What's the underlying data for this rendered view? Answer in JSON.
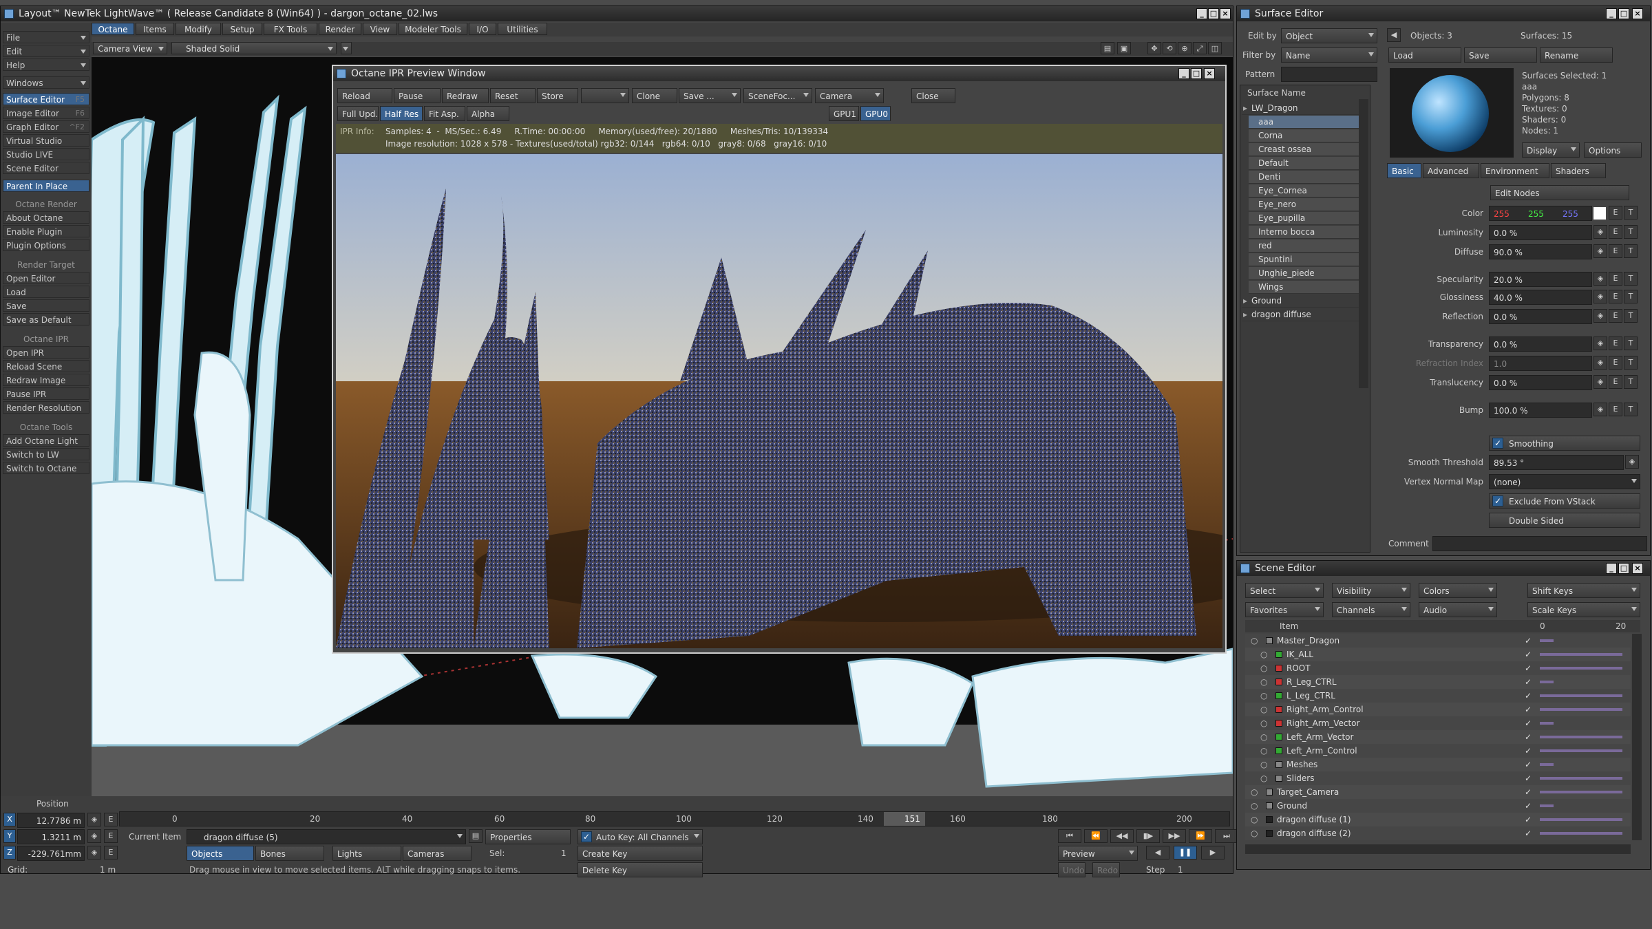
{
  "main_window": {
    "title": "Layout™ NewTek LightWave™ ( Release Candidate 8 (Win64) ) - dargon_octane_02.lws",
    "tabs": [
      "Octane",
      "Items",
      "Modify",
      "Setup",
      "FX Tools",
      "Render",
      "View",
      "Modeler Tools",
      "I/O",
      "Utilities"
    ]
  },
  "viewport_bar": {
    "camera": "Camera View",
    "shading": "Shaded Solid"
  },
  "left_menu": {
    "top": [
      {
        "label": "File"
      },
      {
        "label": "Edit"
      },
      {
        "label": "Help"
      },
      {
        "label": "Windows"
      }
    ],
    "editors": [
      {
        "label": "Surface Editor",
        "shortcut": "F5"
      },
      {
        "label": "Image Editor",
        "shortcut": "F6"
      },
      {
        "label": "Graph Editor",
        "shortcut": "^F2"
      },
      {
        "label": "Virtual Studio",
        "shortcut": ""
      },
      {
        "label": "Studio LIVE",
        "shortcut": ""
      },
      {
        "label": "Scene Editor",
        "shortcut": ""
      }
    ],
    "parent_in_place": "Parent In Place",
    "sections": [
      {
        "head": "Octane Render",
        "items": [
          "About Octane",
          "Enable Plugin",
          "Plugin Options"
        ]
      },
      {
        "head": "Render Target",
        "items": [
          "Open Editor",
          "Load",
          "Save",
          "Save as Default"
        ]
      },
      {
        "head": "Octane IPR",
        "items": [
          "Open IPR",
          "Reload Scene",
          "Redraw Image",
          "Pause IPR",
          "Render Resolution"
        ]
      },
      {
        "head": "Octane Tools",
        "items": [
          "Add Octane Light",
          "Switch to LW",
          "Switch to Octane"
        ]
      }
    ]
  },
  "ipr": {
    "title": "Octane IPR Preview Window",
    "row1": [
      "Reload",
      "Pause",
      "Redraw",
      "Reset",
      "Store",
      "",
      "Clone",
      "Save ...",
      "SceneFoc...",
      "Camera",
      "Close"
    ],
    "row2": [
      "Full Upd.",
      "Half Res",
      "Fit Asp.",
      "Alpha"
    ],
    "gpus": [
      "GPU1",
      "GPU0"
    ],
    "info_label": "IPR Info:",
    "info_line1": "Samples: 4  -  MS/Sec.: 6.49     R.Time: 00:00:00     Memory(used/free): 20/1880     Meshes/Tris: 10/139334",
    "info_line2": "Image resolution: 1028 x 578 - Textures(used/total) rgb32: 0/144   rgb64: 0/10   gray8: 0/68   gray16: 0/10"
  },
  "bottom": {
    "position_label": "Position",
    "x": "12.7786 m",
    "y": "1.3211 m",
    "z": "-229.761mm",
    "grid_label": "Grid:",
    "grid": "1 m",
    "axes": [
      "X",
      "Y",
      "Z"
    ],
    "ticks": [
      "0",
      "20",
      "40",
      "60",
      "80",
      "100",
      "120",
      "140",
      "160",
      "180",
      "200"
    ],
    "frame_start": "0",
    "frame_end": "200",
    "current_frame": "151",
    "current_item_label": "Current Item",
    "current_item": "dragon diffuse (5)",
    "properties": "Properties",
    "auto_key": "Auto Key: All Channels",
    "create_key": "Create Key",
    "delete_key": "Delete Key",
    "filters": [
      "Objects",
      "Bones",
      "Lights",
      "Cameras"
    ],
    "sel_label": "Sel:",
    "sel_value": "1",
    "status": "Drag mouse in view to move selected items. ALT while dragging snaps to items.",
    "preview": "Preview",
    "undo": "Undo",
    "redo": "Redo",
    "step_label": "Step",
    "step_value": "1"
  },
  "surface_editor": {
    "title": "Surface Editor",
    "edit_by_label": "Edit by",
    "edit_by": "Object",
    "filter_by_label": "Filter by",
    "filter_by": "Name",
    "pattern_label": "Pattern",
    "objects": "Objects: 3",
    "surfaces": "Surfaces: 15",
    "load": "Load",
    "save": "Save",
    "rename": "Rename",
    "tree_header": "Surface Name",
    "tree": [
      {
        "label": "LW_Dragon",
        "type": "group"
      },
      {
        "label": "aaa",
        "sel": true
      },
      {
        "label": "Corna"
      },
      {
        "label": "Creast ossea"
      },
      {
        "label": "Default"
      },
      {
        "label": "Denti"
      },
      {
        "label": "Eye_Cornea"
      },
      {
        "label": "Eye_nero"
      },
      {
        "label": "Eye_pupilla"
      },
      {
        "label": "Interno bocca"
      },
      {
        "label": "red"
      },
      {
        "label": "Spuntini"
      },
      {
        "label": "Unghie_piede"
      },
      {
        "label": "Wings"
      },
      {
        "label": "Ground",
        "type": "group"
      },
      {
        "label": "dragon diffuse",
        "type": "group"
      }
    ],
    "info": [
      "Surfaces Selected: 1",
      "aaa",
      "Polygons: 8",
      "Textures: 0",
      "Shaders: 0",
      "Nodes: 1"
    ],
    "display": "Display",
    "options": "Options",
    "tabs": [
      "Basic",
      "Advanced",
      "Environment",
      "Shaders"
    ],
    "edit_nodes": "Edit Nodes",
    "color_label": "Color",
    "color_r": "255",
    "color_g": "255",
    "color_b": "255",
    "props": [
      {
        "label": "Luminosity",
        "value": "0.0 %"
      },
      {
        "label": "Diffuse",
        "value": "90.0 %"
      },
      {
        "label": "Specularity",
        "value": "20.0 %"
      },
      {
        "label": "Glossiness",
        "value": "40.0 %"
      },
      {
        "label": "Reflection",
        "value": "0.0 %"
      },
      {
        "label": "Transparency",
        "value": "0.0 %"
      },
      {
        "label": "Refraction Index",
        "value": "1.0"
      },
      {
        "label": "Translucency",
        "value": "0.0 %"
      },
      {
        "label": "Bump",
        "value": "100.0 %"
      }
    ],
    "smoothing": "Smoothing",
    "smooth_threshold_label": "Smooth Threshold",
    "smooth_threshold": "89.53 °",
    "vertex_normal_label": "Vertex Normal Map",
    "vertex_normal": "(none)",
    "exclude_vstack": "Exclude From VStack",
    "double_sided": "Double Sided",
    "comment_label": "Comment",
    "e": "E",
    "t": "T"
  },
  "scene_editor": {
    "title": "Scene Editor",
    "dropdowns": [
      "Select",
      "Visibility",
      "Colors",
      "Favorites",
      "Channels",
      "Audio"
    ],
    "shift_keys": "Shift Keys",
    "scale_keys": "Scale Keys",
    "item_header": "Item",
    "tl_start": "0",
    "tl_end": "20",
    "items": [
      {
        "label": "Master_Dragon",
        "indent": 0,
        "color": "#888"
      },
      {
        "label": "IK_ALL",
        "indent": 1,
        "color": "#3a3"
      },
      {
        "label": "ROOT",
        "indent": 1,
        "color": "#c33"
      },
      {
        "label": "R_Leg_CTRL",
        "indent": 1,
        "color": "#c33"
      },
      {
        "label": "L_Leg_CTRL",
        "indent": 1,
        "color": "#3a3"
      },
      {
        "label": "Right_Arm_Control",
        "indent": 1,
        "color": "#c33"
      },
      {
        "label": "Right_Arm_Vector",
        "indent": 1,
        "color": "#c33"
      },
      {
        "label": "Left_Arm_Vector",
        "indent": 1,
        "color": "#3a3"
      },
      {
        "label": "Left_Arm_Control",
        "indent": 1,
        "color": "#3a3"
      },
      {
        "label": "Meshes",
        "indent": 1,
        "color": "#888"
      },
      {
        "label": "Sliders",
        "indent": 1,
        "color": "#888"
      },
      {
        "label": "Target_Camera",
        "indent": 0,
        "color": "#888"
      },
      {
        "label": "Ground",
        "indent": 0,
        "color": "#888"
      },
      {
        "label": "dragon diffuse (1)",
        "indent": 0,
        "color": "#222"
      },
      {
        "label": "dragon diffuse (2)",
        "indent": 0,
        "color": "#222"
      }
    ]
  }
}
